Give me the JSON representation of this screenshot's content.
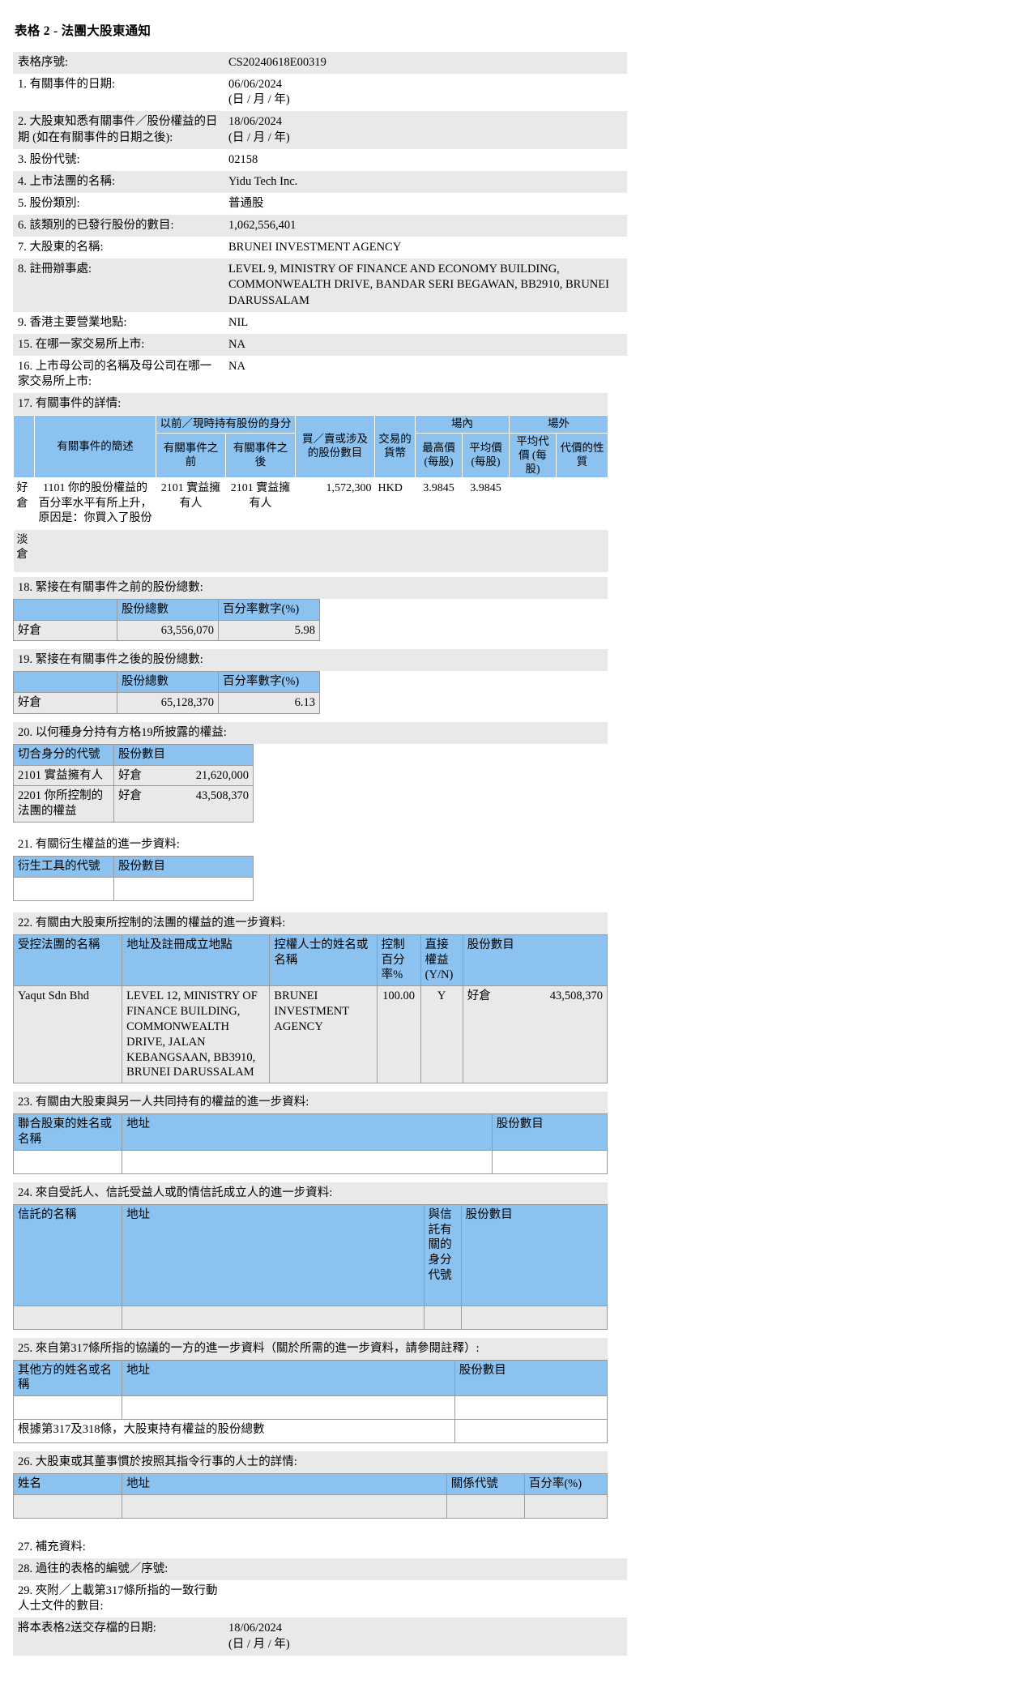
{
  "form": {
    "title": "表格 2 - 法團大股東通知"
  },
  "top_fields": [
    {
      "label": "表格序號:",
      "value": "CS20240618E00319",
      "sub": ""
    },
    {
      "label": "1. 有關事件的日期:",
      "value": "06/06/2024",
      "sub": "(日 / 月 / 年)"
    },
    {
      "label": "2. 大股東知悉有關事件／股份權益的日期 (如在有關事件的日期之後):",
      "value": "18/06/2024",
      "sub": "(日 / 月 / 年)"
    },
    {
      "label": "3. 股份代號:",
      "value": "02158",
      "sub": ""
    },
    {
      "label": "4. 上市法團的名稱:",
      "value": "Yidu Tech Inc.",
      "sub": ""
    },
    {
      "label": "5. 股份類別:",
      "value": "普通股",
      "sub": ""
    },
    {
      "label": "6. 該類別的已發行股份的數目:",
      "value": "1,062,556,401",
      "sub": ""
    },
    {
      "label": "7. 大股東的名稱:",
      "value": "BRUNEI INVESTMENT AGENCY",
      "sub": ""
    },
    {
      "label": "8. 註冊辦事處:",
      "value": "LEVEL 9, MINISTRY OF FINANCE AND ECONOMY BUILDING, COMMONWEALTH DRIVE, BANDAR SERI BEGAWAN, BB2910, BRUNEI DARUSSALAM",
      "sub": ""
    },
    {
      "label": "9. 香港主要營業地點:",
      "value": "NIL",
      "sub": ""
    },
    {
      "label": "15. 在哪一家交易所上市:",
      "value": "NA",
      "sub": ""
    },
    {
      "label": "16. 上市母公司的名稱及母公司在哪一家交易所上市:",
      "value": "NA",
      "sub": ""
    }
  ],
  "section17": {
    "caption": "17. 有關事件的詳情:",
    "headers": {
      "blank": "",
      "description": "有關事件的簡述",
      "capacity_group": "以前／現時持有股份的身分",
      "before": "有關事件之前",
      "after": "有關事件之後",
      "shares_involved": "買／賣或涉及的股份數目",
      "currency": "交易的貨幣",
      "on_exchange": "場內",
      "off_exchange": "場外",
      "highest_price": "最高價 (每股)",
      "average_price": "平均價 (每股)",
      "avg_consideration": "平均代價 (每股)",
      "nature_consideration": "代價的性質"
    },
    "rows": [
      {
        "position": "好倉",
        "desc_code": "1101",
        "desc_text": "你的股份權益的百分率水平有所上升，原因是：你買入了股份",
        "before_code": "2101",
        "before_text": "實益擁有人",
        "after_code": "2101",
        "after_text": "實益擁有人",
        "shares": "1,572,300",
        "currency": "HKD",
        "highest": "3.9845",
        "average": "3.9845",
        "avg_consideration": "",
        "nature": ""
      },
      {
        "position": "淡倉",
        "desc_code": "",
        "desc_text": "",
        "before_code": "",
        "before_text": "",
        "after_code": "",
        "after_text": "",
        "shares": "",
        "currency": "",
        "highest": "",
        "average": "",
        "avg_consideration": "",
        "nature": ""
      }
    ]
  },
  "section18": {
    "caption": "18. 緊接在有關事件之前的股份總數:",
    "headers": [
      "",
      "股份總數",
      "百分率數字(%)"
    ],
    "rows": [
      {
        "position": "好倉",
        "total": "63,556,070",
        "percent": "5.98"
      }
    ]
  },
  "section19": {
    "caption": "19. 緊接在有關事件之後的股份總數:",
    "headers": [
      "",
      "股份總數",
      "百分率數字(%)"
    ],
    "rows": [
      {
        "position": "好倉",
        "total": "65,128,370",
        "percent": "6.13"
      }
    ]
  },
  "section20": {
    "caption": "20. 以何種身分持有方格19所披露的權益:",
    "headers": [
      "切合身分的代號",
      "股份數目"
    ],
    "rows": [
      {
        "code": "2101",
        "code_text": "實益擁有人",
        "position": "好倉",
        "shares": "21,620,000"
      },
      {
        "code": "2201",
        "code_text": "你所控制的法團的權益",
        "position": "好倉",
        "shares": "43,508,370"
      }
    ]
  },
  "section21": {
    "caption": "21. 有關衍生權益的進一步資料:",
    "headers": [
      "衍生工具的代號",
      "股份數目"
    ],
    "rows": [
      {
        "code": "",
        "shares": ""
      }
    ]
  },
  "section22": {
    "caption": "22. 有關由大股東所控制的法團的權益的進一步資料:",
    "headers": [
      "受控法團的名稱",
      "地址及註冊成立地點",
      "控權人士的姓名或名稱",
      "控制百分率%",
      "直接權益 (Y/N)",
      "股份數目"
    ],
    "rows": [
      {
        "name": "Yaqut Sdn Bhd",
        "address": "LEVEL 12, MINISTRY OF FINANCE BUILDING, COMMONWEALTH DRIVE, JALAN KEBANGSAAN, BB3910, BRUNEI DARUSSALAM",
        "controller": "BRUNEI INVESTMENT AGENCY",
        "control_pct": "100.00",
        "direct": "Y",
        "position": "好倉",
        "shares": "43,508,370"
      }
    ]
  },
  "section23": {
    "caption": "23. 有關由大股東與另一人共同持有的權益的進一步資料:",
    "headers": [
      "聯合股東的姓名或名稱",
      "地址",
      "股份數目"
    ],
    "rows": [
      {
        "name": "",
        "address": "",
        "shares": ""
      }
    ]
  },
  "section24": {
    "caption": "24. 來自受託人、信託受益人或酌情信託成立人的進一步資料:",
    "headers": [
      "信託的名稱",
      "地址",
      "與信託有關的身分代號",
      "股份數目"
    ],
    "rows": [
      {
        "name": "",
        "address": "",
        "capacity": "",
        "shares": ""
      }
    ]
  },
  "section25": {
    "caption": "25. 來自第317條所指的協議的一方的進一步資料（關於所需的進一步資料，請參閱註釋）:",
    "headers": [
      "其他方的姓名或名稱",
      "地址",
      "股份數目"
    ],
    "rows": [
      {
        "name": "",
        "address": "",
        "shares": ""
      }
    ],
    "total_label": "根據第317及318條，大股東持有權益的股份總數",
    "total_value": ""
  },
  "section26": {
    "caption": "26. 大股東或其董事慣於按照其指令行事的人士的詳情:",
    "headers": [
      "姓名",
      "地址",
      "關係代號",
      "百分率(%)"
    ],
    "rows": [
      {
        "name": "",
        "address": "",
        "relation": "",
        "percent": ""
      }
    ]
  },
  "bottom_fields": [
    {
      "label": "27. 補充資料:",
      "value": "",
      "sub": "",
      "shaded": false,
      "hasvalue": false
    },
    {
      "label": "28. 過往的表格的編號／序號:",
      "value": "",
      "sub": "",
      "shaded": true,
      "hasvalue": true
    },
    {
      "label": "29. 夾附／上載第317條所指的一致行動人士文件的數目:",
      "value": "",
      "sub": "",
      "shaded": false,
      "hasvalue": false
    },
    {
      "label": "將本表格2送交存檔的日期:",
      "value": "18/06/2024",
      "sub": "(日 / 月 / 年)",
      "shaded": true,
      "hasvalue": true
    }
  ]
}
